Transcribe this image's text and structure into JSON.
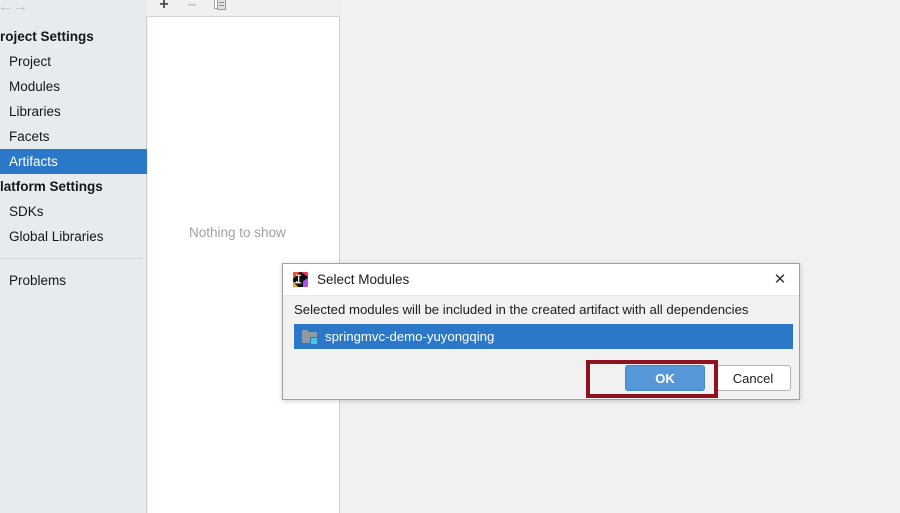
{
  "window": {
    "nav_forward_icon": "arrow-right-icon",
    "sidebar": {
      "groups": [
        {
          "label": "Project Settings",
          "items": [
            {
              "label": "Project",
              "selected": false
            },
            {
              "label": "Modules",
              "selected": false
            },
            {
              "label": "Libraries",
              "selected": false
            },
            {
              "label": "Facets",
              "selected": false
            },
            {
              "label": "Artifacts",
              "selected": true
            }
          ]
        },
        {
          "label": "Platform Settings",
          "items": [
            {
              "label": "SDKs",
              "selected": false
            },
            {
              "label": "Global Libraries",
              "selected": false
            }
          ]
        }
      ],
      "footer_items": [
        {
          "label": "Problems"
        }
      ],
      "selection_color": "#2b78c8",
      "background_color": "#e6ebee"
    },
    "artifacts_panel": {
      "toolbar": {
        "add_icon": "plus-icon",
        "add_label": "+",
        "remove_icon": "minus-icon",
        "remove_label": "–",
        "copy_icon": "copy-icon"
      },
      "empty_message": "Nothing to show"
    }
  },
  "dialog": {
    "app_icon": "intellij-idea-logo-icon",
    "title": "Select Modules",
    "close_icon": "close-icon",
    "close_label": "✕",
    "message": "Selected modules will be included in the created artifact with all dependencies",
    "modules": [
      {
        "name": "springmvc-demo-yuyongqing",
        "icon": "module-folder-icon",
        "selected": true
      }
    ],
    "buttons": {
      "ok_label": "OK",
      "cancel_label": "Cancel",
      "ok_color": "#5697d7"
    }
  },
  "annotation": {
    "highlight_color": "#8e1220",
    "target": "ok-button"
  }
}
